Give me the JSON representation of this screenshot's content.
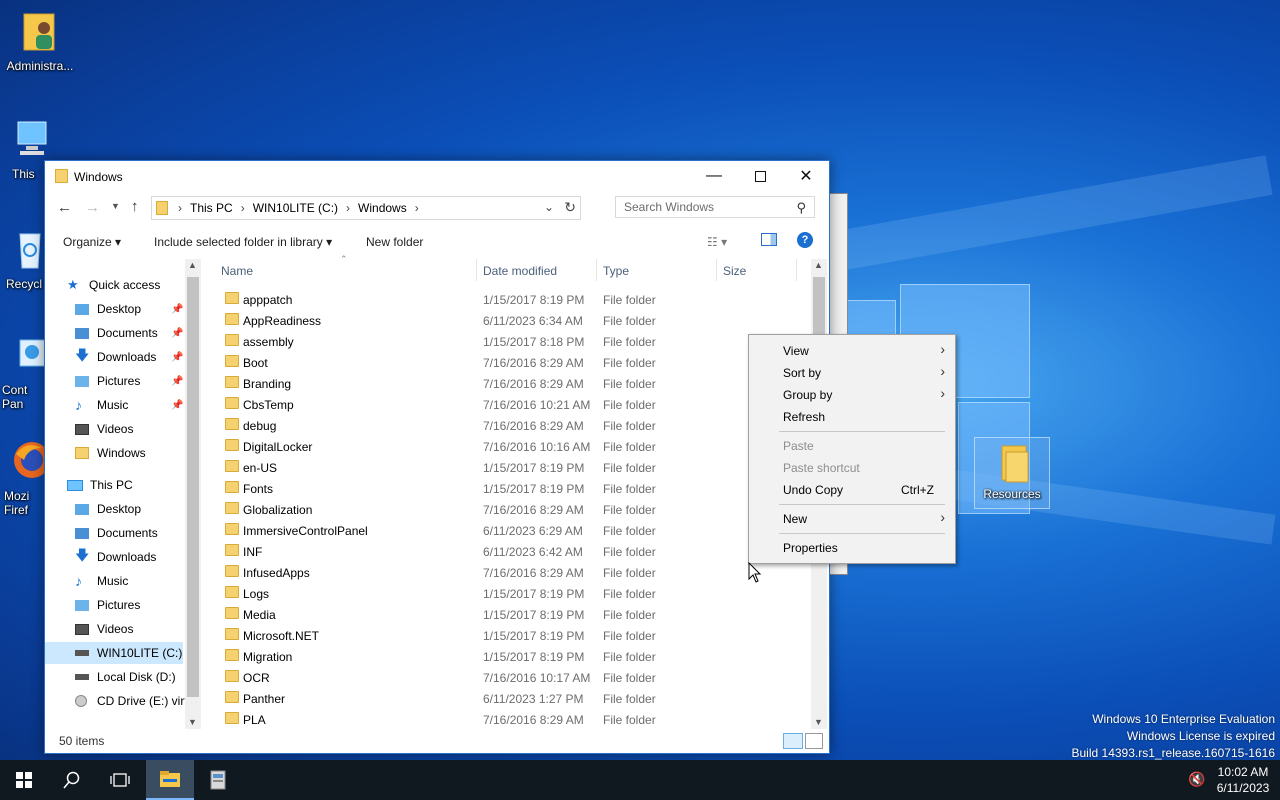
{
  "desktop": {
    "icons": [
      {
        "label": "Administra..."
      },
      {
        "label": "This"
      },
      {
        "label": "Recycl"
      },
      {
        "label": "Cont Pan"
      },
      {
        "label": "Mozi Firef"
      },
      {
        "label": "Resources"
      }
    ],
    "watermark": {
      "line1": "Windows 10 Enterprise Evaluation",
      "line2": "Windows License is expired",
      "line3": "Build 14393.rs1_release.160715-1616"
    }
  },
  "window": {
    "title": "Windows",
    "breadcrumb": [
      "This PC",
      "WIN10LITE (C:)",
      "Windows"
    ],
    "search_placeholder": "Search Windows",
    "commands": {
      "organize": "Organize",
      "include": "Include selected folder in library",
      "new_folder": "New folder"
    },
    "nav": [
      {
        "label": "Quick access",
        "icon": "star-icon"
      },
      {
        "label": "Desktop",
        "icon": "desktop-folder-icon",
        "pinned": true
      },
      {
        "label": "Documents",
        "icon": "documents-icon",
        "pinned": true
      },
      {
        "label": "Downloads",
        "icon": "downloads-icon",
        "pinned": true
      },
      {
        "label": "Pictures",
        "icon": "pictures-icon",
        "pinned": true
      },
      {
        "label": "Music",
        "icon": "music-icon",
        "pinned": true
      },
      {
        "label": "Videos",
        "icon": "videos-icon"
      },
      {
        "label": "Windows",
        "icon": "folder-icon"
      },
      {
        "label": "This PC",
        "icon": "computer-icon"
      },
      {
        "label": "Desktop",
        "icon": "desktop-folder-icon"
      },
      {
        "label": "Documents",
        "icon": "documents-icon"
      },
      {
        "label": "Downloads",
        "icon": "downloads-icon"
      },
      {
        "label": "Music",
        "icon": "music-icon"
      },
      {
        "label": "Pictures",
        "icon": "pictures-icon"
      },
      {
        "label": "Videos",
        "icon": "videos-icon"
      },
      {
        "label": "WIN10LITE (C:)",
        "icon": "drive-icon",
        "selected": true
      },
      {
        "label": "Local Disk (D:)",
        "icon": "drive-icon"
      },
      {
        "label": "CD Drive (E:) virt",
        "icon": "cd-drive-icon"
      }
    ],
    "columns": {
      "name": "Name",
      "date": "Date modified",
      "type": "Type",
      "size": "Size"
    },
    "files": [
      {
        "name": "apppatch",
        "date": "1/15/2017 8:19 PM",
        "type": "File folder"
      },
      {
        "name": "AppReadiness",
        "date": "6/11/2023 6:34 AM",
        "type": "File folder"
      },
      {
        "name": "assembly",
        "date": "1/15/2017 8:18 PM",
        "type": "File folder"
      },
      {
        "name": "Boot",
        "date": "7/16/2016 8:29 AM",
        "type": "File folder"
      },
      {
        "name": "Branding",
        "date": "7/16/2016 8:29 AM",
        "type": "File folder"
      },
      {
        "name": "CbsTemp",
        "date": "7/16/2016 10:21 AM",
        "type": "File folder"
      },
      {
        "name": "debug",
        "date": "7/16/2016 8:29 AM",
        "type": "File folder"
      },
      {
        "name": "DigitalLocker",
        "date": "7/16/2016 10:16 AM",
        "type": "File folder"
      },
      {
        "name": "en-US",
        "date": "1/15/2017 8:19 PM",
        "type": "File folder"
      },
      {
        "name": "Fonts",
        "date": "1/15/2017 8:19 PM",
        "type": "File folder"
      },
      {
        "name": "Globalization",
        "date": "7/16/2016 8:29 AM",
        "type": "File folder"
      },
      {
        "name": "ImmersiveControlPanel",
        "date": "6/11/2023 6:29 AM",
        "type": "File folder"
      },
      {
        "name": "INF",
        "date": "6/11/2023 6:42 AM",
        "type": "File folder"
      },
      {
        "name": "InfusedApps",
        "date": "7/16/2016 8:29 AM",
        "type": "File folder"
      },
      {
        "name": "Logs",
        "date": "1/15/2017 8:19 PM",
        "type": "File folder"
      },
      {
        "name": "Media",
        "date": "1/15/2017 8:19 PM",
        "type": "File folder"
      },
      {
        "name": "Microsoft.NET",
        "date": "1/15/2017 8:19 PM",
        "type": "File folder"
      },
      {
        "name": "Migration",
        "date": "1/15/2017 8:19 PM",
        "type": "File folder"
      },
      {
        "name": "OCR",
        "date": "7/16/2016 10:17 AM",
        "type": "File folder"
      },
      {
        "name": "Panther",
        "date": "6/11/2023 1:27 PM",
        "type": "File folder"
      },
      {
        "name": "PLA",
        "date": "7/16/2016 8:29 AM",
        "type": "File folder"
      }
    ],
    "status": "50 items"
  },
  "context_menu": {
    "view": "View",
    "sort_by": "Sort by",
    "group_by": "Group by",
    "refresh": "Refresh",
    "paste": "Paste",
    "paste_shortcut": "Paste shortcut",
    "undo_copy": "Undo Copy",
    "undo_shortcut": "Ctrl+Z",
    "new": "New",
    "properties": "Properties"
  },
  "taskbar": {
    "time": "10:02 AM",
    "date": "6/11/2023"
  },
  "colors": {
    "accent": "#0078d7",
    "selection": "#cce8ff",
    "taskbar": "#101820"
  }
}
